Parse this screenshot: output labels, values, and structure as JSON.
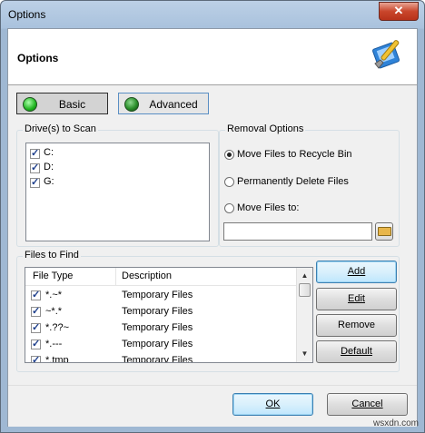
{
  "window": {
    "title": "Options",
    "close_label": "✕"
  },
  "header": {
    "title": "Options",
    "icon": "options-wrench-icon"
  },
  "modes": {
    "basic": "Basic",
    "advanced": "Advanced"
  },
  "drives": {
    "label": "Drive(s) to Scan",
    "items": [
      {
        "label": "C:",
        "checked": true
      },
      {
        "label": "D:",
        "checked": true
      },
      {
        "label": "G:",
        "checked": true
      }
    ]
  },
  "removal": {
    "label": "Removal Options",
    "options": [
      {
        "label": "Move Files to Recycle Bin",
        "selected": true
      },
      {
        "label": "Permanently Delete Files",
        "selected": false
      },
      {
        "label": "Move Files to:",
        "selected": false
      }
    ],
    "path_value": ""
  },
  "files": {
    "label": "Files to Find",
    "columns": [
      "File Type",
      "Description"
    ],
    "rows": [
      {
        "type": "*.~*",
        "desc": "Temporary Files",
        "checked": true
      },
      {
        "type": "~*.*",
        "desc": "Temporary Files",
        "checked": true
      },
      {
        "type": "*.??~",
        "desc": "Temporary Files",
        "checked": true
      },
      {
        "type": "*.---",
        "desc": "Temporary Files",
        "checked": true
      },
      {
        "type": "*.tmp",
        "desc": "Temporary Files",
        "checked": true
      }
    ],
    "buttons": {
      "add": "Add",
      "edit": "Edit",
      "remove": "Remove",
      "default": "Default"
    }
  },
  "footer": {
    "ok": "OK",
    "cancel": "Cancel"
  },
  "watermark": "wsxdn.com"
}
